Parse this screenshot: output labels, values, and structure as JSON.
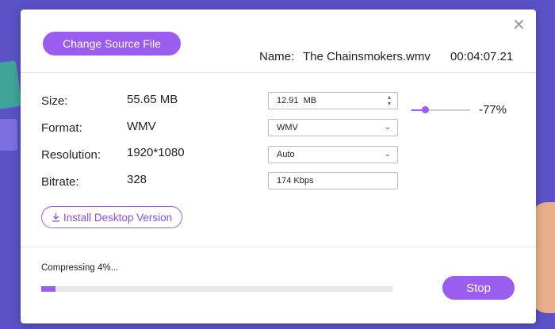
{
  "header": {
    "change_source_label": "Change Source File",
    "name_label": "Name:",
    "file_name": "The Chainsmokers.wmv",
    "duration": "00:04:07.21",
    "close_icon": "close-icon"
  },
  "rows": [
    {
      "label": "Size:",
      "value": "55.65 MB",
      "control_value": "12.91  MB"
    },
    {
      "label": "Format:",
      "value": "WMV",
      "control_value": "WMV"
    },
    {
      "label": "Resolution:",
      "value": "1920*1080",
      "control_value": "Auto"
    },
    {
      "label": "Bitrate:",
      "value": "328",
      "control_value": "174 Kbps"
    }
  ],
  "compression": {
    "percent_label": "-77%",
    "slider_fraction": 0.23
  },
  "install_label": "Install Desktop Version",
  "progress": {
    "text": "Compressing 4%...",
    "fraction": 0.04
  },
  "stop_label": "Stop",
  "colors": {
    "accent": "#9b5cf0",
    "background": "#5b52c8"
  }
}
